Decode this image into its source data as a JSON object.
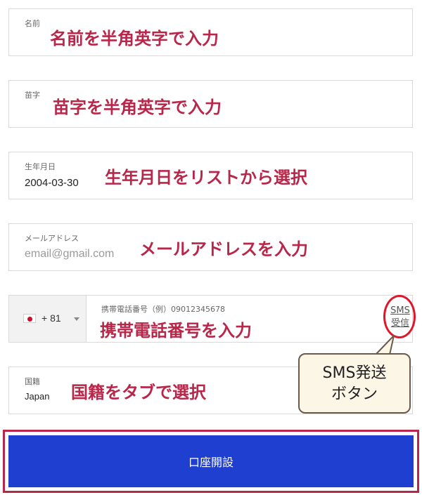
{
  "fields": {
    "first_name": {
      "label": "名前",
      "annotation": "名前を半角英字で入力"
    },
    "last_name": {
      "label": "苗字",
      "annotation": "苗字を半角英字で入力"
    },
    "birthdate": {
      "label": "生年月日",
      "value": "2004-03-30",
      "annotation": "生年月日をリストから選択"
    },
    "email": {
      "label": "メールアドレス",
      "placeholder": "email@gmail.com",
      "annotation": "メールアドレスを入力"
    },
    "phone": {
      "country_code": "+ 81",
      "label": "携帯電話番号（例）09012345678",
      "sms_line1": "SMS",
      "sms_line2": "受信",
      "annotation": "携帯電話番号を入力"
    },
    "nationality": {
      "label": "国籍",
      "value": "Japan",
      "annotation": "国籍をタブで選択"
    }
  },
  "callout": {
    "line1": "SMS発送",
    "line2": "ボタン"
  },
  "submit": {
    "label": "口座開設"
  },
  "colors": {
    "annotation": "#b8264a",
    "button": "#1e3fcf",
    "highlight_ring": "#e0162b"
  }
}
